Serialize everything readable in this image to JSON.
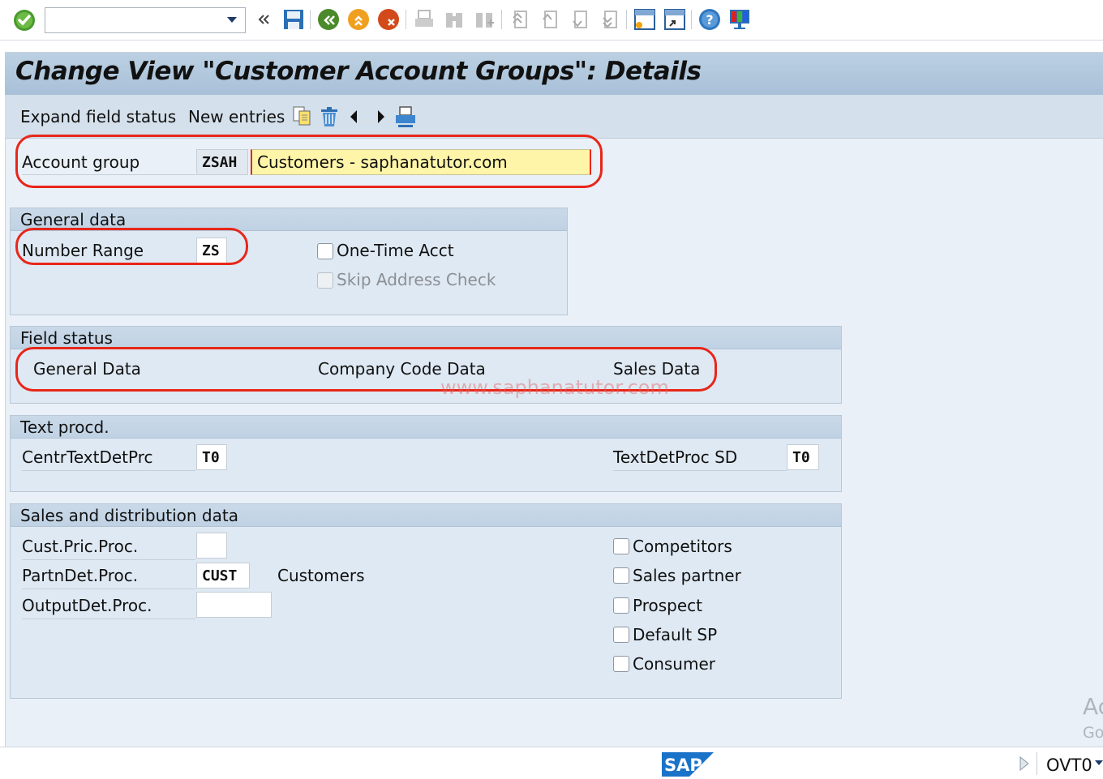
{
  "toolbar": {
    "command_field_value": "",
    "icons": [
      "enter-checkmark-icon",
      "command-dropdown-icon",
      "collapse-chevrons-icon",
      "save-icon",
      "back-icon",
      "exit-icon",
      "cancel-icon",
      "print-icon",
      "find-icon",
      "find-next-icon",
      "first-page-icon",
      "previous-page-icon",
      "next-page-icon",
      "last-page-icon",
      "create-session-icon",
      "create-shortcut-icon",
      "help-icon",
      "customize-layout-icon"
    ]
  },
  "header": {
    "title": "Change View \"Customer Account Groups\": Details"
  },
  "app_toolbar": {
    "expand_field_status": "Expand field status",
    "new_entries": "New entries",
    "icons": [
      "copy-icon",
      "delete-icon",
      "previous-entry-icon",
      "next-entry-icon",
      "print-icon"
    ]
  },
  "account_group": {
    "label": "Account group",
    "code": "ZSAH",
    "description": "Customers - saphanatutor.com"
  },
  "general_data": {
    "title": "General data",
    "number_range_label": "Number Range",
    "number_range_value": "ZS",
    "one_time_acct": {
      "label": "One-Time Acct",
      "checked": false,
      "enabled": true
    },
    "skip_address_check": {
      "label": "Skip Address Check",
      "checked": false,
      "enabled": false
    }
  },
  "field_status": {
    "title": "Field status",
    "links": [
      "General Data",
      "Company Code Data",
      "Sales Data"
    ]
  },
  "watermark": "www.saphanatutor.com",
  "text_procd": {
    "title": "Text procd.",
    "centr_label": "CentrTextDetPrc",
    "centr_value": "T0",
    "sd_label": "TextDetProc SD",
    "sd_value": "T0"
  },
  "sales_distribution": {
    "title": "Sales and distribution data",
    "cust_pric_label": "Cust.Pric.Proc.",
    "cust_pric_value": "",
    "partn_det_label": "PartnDet.Proc.",
    "partn_det_value": "CUST",
    "partn_det_desc": "Customers",
    "output_det_label": "OutputDet.Proc.",
    "output_det_value": "",
    "checkboxes": [
      {
        "label": "Competitors",
        "checked": false
      },
      {
        "label": "Sales partner",
        "checked": false
      },
      {
        "label": "Prospect",
        "checked": false
      },
      {
        "label": "Default SP",
        "checked": false
      },
      {
        "label": "Consumer",
        "checked": false
      }
    ]
  },
  "activation": {
    "line1": "Ac",
    "line2": "Go"
  },
  "statusbar": {
    "logo": "SAP",
    "transaction": "OVT0"
  },
  "colors": {
    "highlight_red": "#e8261a",
    "title_bar": "#a8c0d8",
    "required_field": "#fff5a8"
  }
}
